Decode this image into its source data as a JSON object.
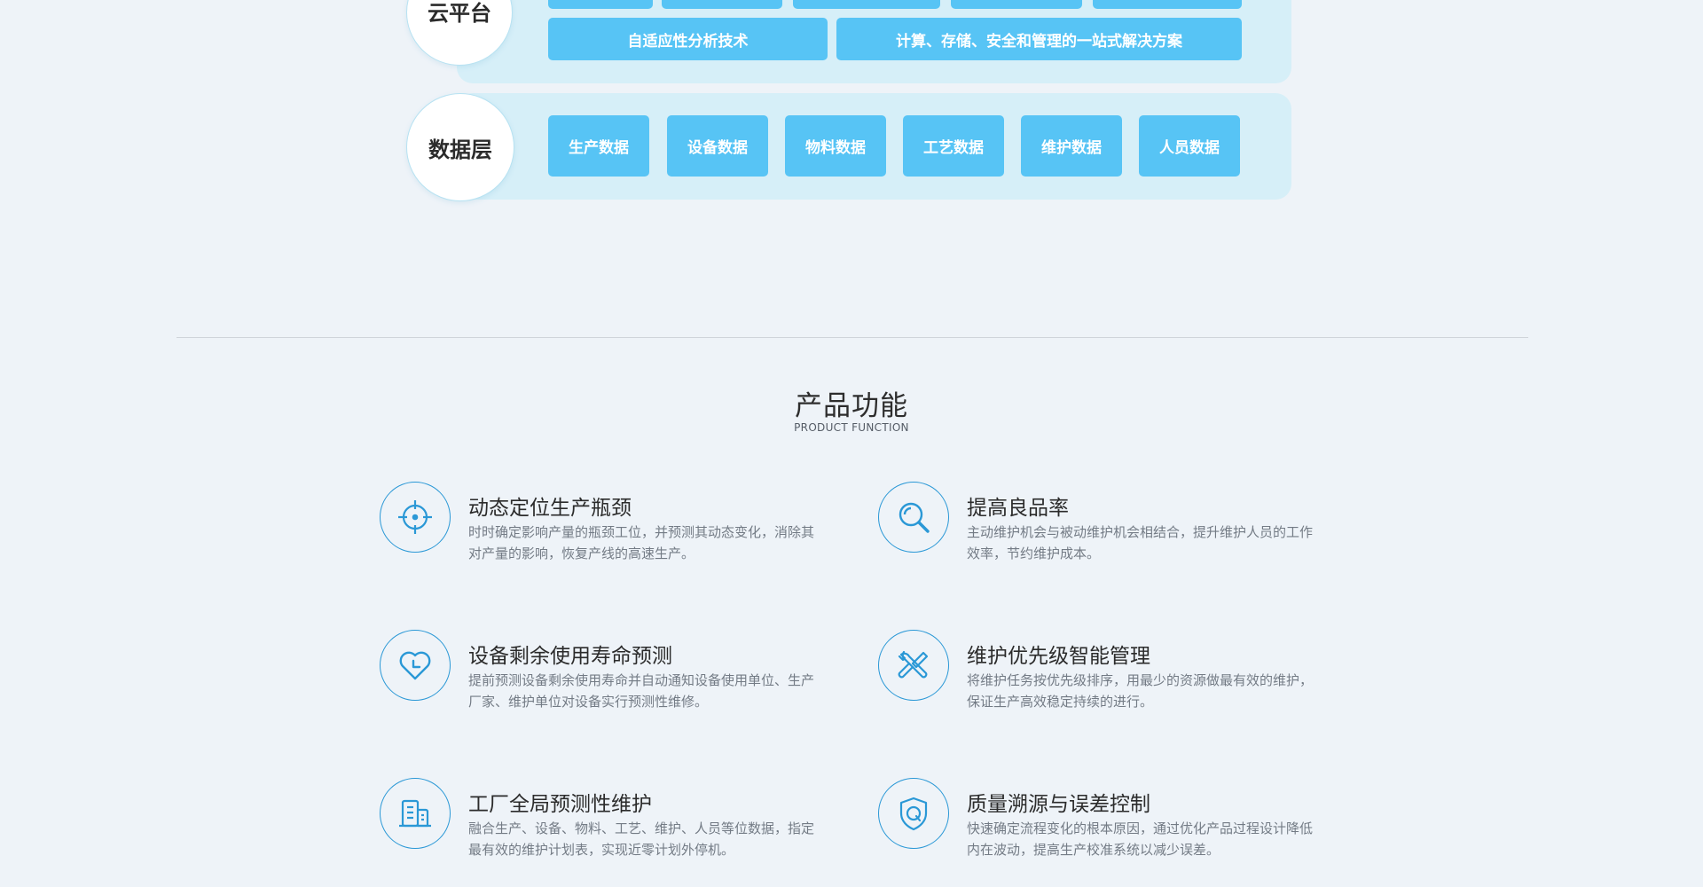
{
  "architecture": {
    "cloud_layer": {
      "label": "云平台",
      "wide_chips": [
        "自适应性分析技术",
        "计算、存储、安全和管理的一站式解决方案"
      ]
    },
    "data_layer": {
      "label": "数据层",
      "chips": [
        "生产数据",
        "设备数据",
        "物料数据",
        "工艺数据",
        "维护数据",
        "人员数据"
      ]
    }
  },
  "product_function": {
    "title": "产品功能",
    "subtitle": "PRODUCT FUNCTION",
    "features": [
      {
        "icon": "crosshair-icon",
        "title": "动态定位生产瓶颈",
        "desc": "时时确定影响产量的瓶颈工位，并预测其动态变化，消除其对产量的影响，恢复产线的高速生产。"
      },
      {
        "icon": "magnifier-icon",
        "title": "提高良品率",
        "desc": "主动维护机会与被动维护机会相结合，提升维护人员的工作效率，节约维护成本。"
      },
      {
        "icon": "heart-clock-icon",
        "title": "设备剩余使用寿命预测",
        "desc": "提前预测设备剩余使用寿命并自动通知设备使用单位、生产厂家、维护单位对设备实行预测性维修。"
      },
      {
        "icon": "tools-icon",
        "title": "维护优先级智能管理",
        "desc": "将维护任务按优先级排序，用最少的资源做最有效的维护，保证生产高效稳定持续的进行。"
      },
      {
        "icon": "factory-icon",
        "title": "工厂全局预测性维护",
        "desc": "融合生产、设备、物料、工艺、维护、人员等位数据，指定最有效的维护计划表，实现近零计划外停机。"
      },
      {
        "icon": "shield-q-icon",
        "title": "质量溯源与误差控制",
        "desc": "快速确定流程变化的根本原因，通过优化产品过程设计降低内在波动，提高生产校准系统以减少误差。"
      }
    ]
  },
  "colors": {
    "accent": "#57c4f5",
    "icon_blue": "#2a98d6",
    "band": "#d6eff8"
  }
}
